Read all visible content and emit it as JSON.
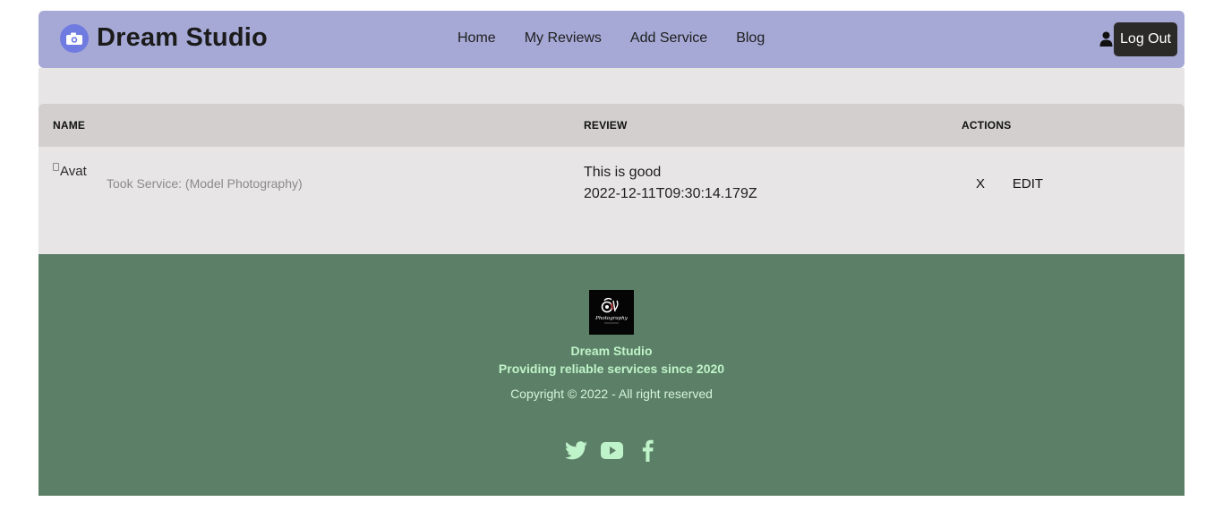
{
  "header": {
    "brand": "Dream Studio",
    "nav": [
      "Home",
      "My Reviews",
      "Add Service",
      "Blog"
    ],
    "logout_label": "Log Out"
  },
  "table": {
    "columns": [
      "NAME",
      "REVIEW",
      "ACTIONS"
    ],
    "rows": [
      {
        "avatar_alt": "Avat",
        "service": "Took Service: (Model Photography)",
        "review": "This is good",
        "date": "2022-12-11T09:30:14.179Z",
        "delete_label": "X",
        "edit_label": "EDIT"
      }
    ]
  },
  "footer": {
    "logo_text": "Photography",
    "title": "Dream Studio",
    "tagline": "Providing reliable services since 2020",
    "copyright": "Copyright © 2022 - All right reserved",
    "social": [
      "twitter-icon",
      "youtube-icon",
      "facebook-icon"
    ]
  },
  "colors": {
    "navbar": "#a6a9d5",
    "brand_icon": "#6f7be0",
    "logout_bg": "#2c2a29",
    "table_bg": "#e8e5e6",
    "table_head": "#d2cfce",
    "footer_bg": "#5c8067",
    "footer_text": "#bff3c9"
  }
}
